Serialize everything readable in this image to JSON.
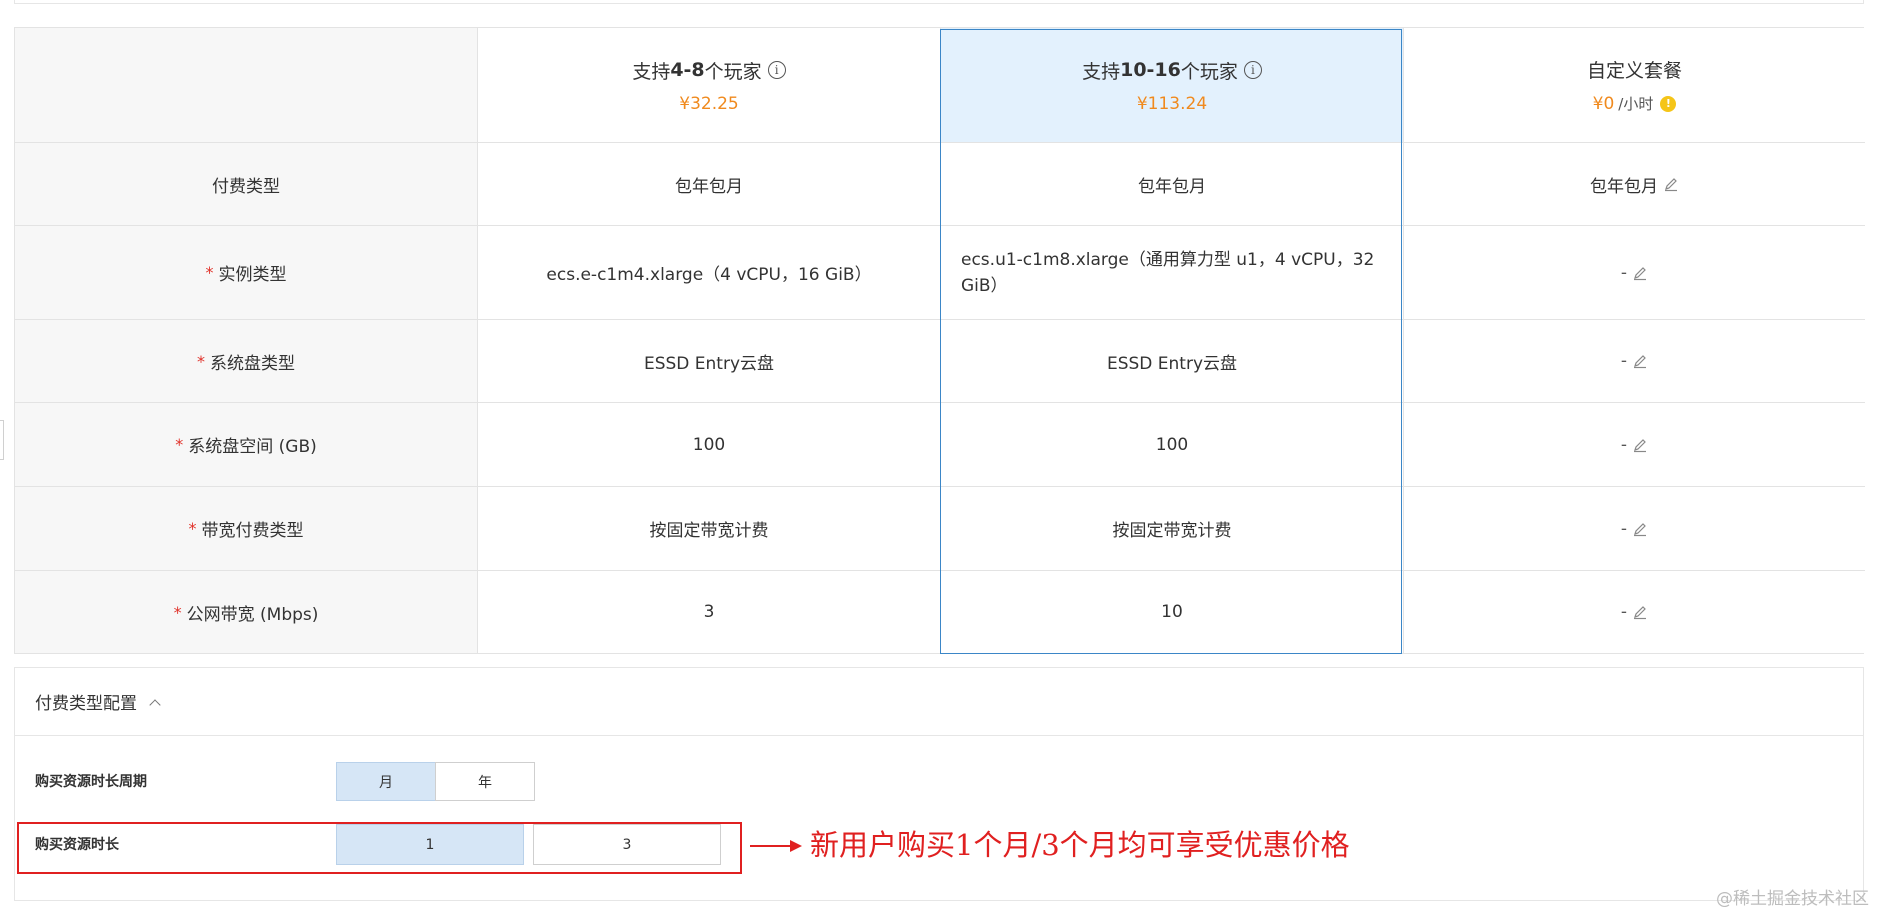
{
  "plans": [
    {
      "name_prefix": "支持",
      "name_range": "4-8",
      "name_suffix": "个玩家",
      "price": "¥32.25"
    },
    {
      "name_prefix": "支持",
      "name_range": "10-16",
      "name_suffix": "个玩家",
      "price": "¥113.24"
    },
    {
      "name": "自定义套餐",
      "price": "¥0",
      "price_unit": "/小时"
    }
  ],
  "rows": [
    {
      "label": "付费类型",
      "required": false,
      "values": [
        "包年包月",
        "包年包月",
        "包年包月"
      ]
    },
    {
      "label": "实例类型",
      "required": true,
      "values": [
        "ecs.e-c1m4.xlarge（4 vCPU，16 GiB）",
        "ecs.u1-c1m8.xlarge（通用算力型 u1，4 vCPU，32 GiB）",
        "-"
      ]
    },
    {
      "label": "系统盘类型",
      "required": true,
      "values": [
        "ESSD Entry云盘",
        "ESSD Entry云盘",
        "-"
      ]
    },
    {
      "label": "系统盘空间 (GB)",
      "required": true,
      "values": [
        "100",
        "100",
        "-"
      ]
    },
    {
      "label": "带宽付费类型",
      "required": true,
      "values": [
        "按固定带宽计费",
        "按固定带宽计费",
        "-"
      ]
    },
    {
      "label": "公网带宽 (Mbps)",
      "required": true,
      "values": [
        "3",
        "10",
        "-"
      ]
    }
  ],
  "required_mark": "*",
  "pay_config": {
    "title": "付费类型配置",
    "period_label": "购买资源时长周期",
    "period_options": [
      "月",
      "年"
    ],
    "period_selected": "月",
    "duration_label": "购买资源时长",
    "duration_options": [
      "1",
      "3"
    ],
    "duration_selected": "1"
  },
  "annotation": "新用户购买1个月/3个月均可享受优惠价格",
  "watermark": "@稀土掘金技术社区",
  "colors": {
    "price": "#f08a1e",
    "selected_border": "#3b86c7",
    "selected_bg": "#e3f1fd",
    "annotation": "#e02020",
    "required": "#e0322a"
  }
}
